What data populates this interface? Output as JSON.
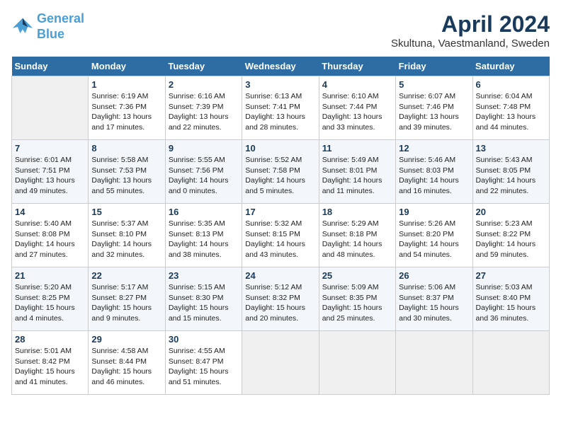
{
  "header": {
    "logo_line1": "General",
    "logo_line2": "Blue",
    "month": "April 2024",
    "location": "Skultuna, Vaestmanland, Sweden"
  },
  "weekdays": [
    "Sunday",
    "Monday",
    "Tuesday",
    "Wednesday",
    "Thursday",
    "Friday",
    "Saturday"
  ],
  "weeks": [
    [
      {
        "day": "",
        "info": ""
      },
      {
        "day": "1",
        "info": "Sunrise: 6:19 AM\nSunset: 7:36 PM\nDaylight: 13 hours\nand 17 minutes."
      },
      {
        "day": "2",
        "info": "Sunrise: 6:16 AM\nSunset: 7:39 PM\nDaylight: 13 hours\nand 22 minutes."
      },
      {
        "day": "3",
        "info": "Sunrise: 6:13 AM\nSunset: 7:41 PM\nDaylight: 13 hours\nand 28 minutes."
      },
      {
        "day": "4",
        "info": "Sunrise: 6:10 AM\nSunset: 7:44 PM\nDaylight: 13 hours\nand 33 minutes."
      },
      {
        "day": "5",
        "info": "Sunrise: 6:07 AM\nSunset: 7:46 PM\nDaylight: 13 hours\nand 39 minutes."
      },
      {
        "day": "6",
        "info": "Sunrise: 6:04 AM\nSunset: 7:48 PM\nDaylight: 13 hours\nand 44 minutes."
      }
    ],
    [
      {
        "day": "7",
        "info": "Sunrise: 6:01 AM\nSunset: 7:51 PM\nDaylight: 13 hours\nand 49 minutes."
      },
      {
        "day": "8",
        "info": "Sunrise: 5:58 AM\nSunset: 7:53 PM\nDaylight: 13 hours\nand 55 minutes."
      },
      {
        "day": "9",
        "info": "Sunrise: 5:55 AM\nSunset: 7:56 PM\nDaylight: 14 hours\nand 0 minutes."
      },
      {
        "day": "10",
        "info": "Sunrise: 5:52 AM\nSunset: 7:58 PM\nDaylight: 14 hours\nand 5 minutes."
      },
      {
        "day": "11",
        "info": "Sunrise: 5:49 AM\nSunset: 8:01 PM\nDaylight: 14 hours\nand 11 minutes."
      },
      {
        "day": "12",
        "info": "Sunrise: 5:46 AM\nSunset: 8:03 PM\nDaylight: 14 hours\nand 16 minutes."
      },
      {
        "day": "13",
        "info": "Sunrise: 5:43 AM\nSunset: 8:05 PM\nDaylight: 14 hours\nand 22 minutes."
      }
    ],
    [
      {
        "day": "14",
        "info": "Sunrise: 5:40 AM\nSunset: 8:08 PM\nDaylight: 14 hours\nand 27 minutes."
      },
      {
        "day": "15",
        "info": "Sunrise: 5:37 AM\nSunset: 8:10 PM\nDaylight: 14 hours\nand 32 minutes."
      },
      {
        "day": "16",
        "info": "Sunrise: 5:35 AM\nSunset: 8:13 PM\nDaylight: 14 hours\nand 38 minutes."
      },
      {
        "day": "17",
        "info": "Sunrise: 5:32 AM\nSunset: 8:15 PM\nDaylight: 14 hours\nand 43 minutes."
      },
      {
        "day": "18",
        "info": "Sunrise: 5:29 AM\nSunset: 8:18 PM\nDaylight: 14 hours\nand 48 minutes."
      },
      {
        "day": "19",
        "info": "Sunrise: 5:26 AM\nSunset: 8:20 PM\nDaylight: 14 hours\nand 54 minutes."
      },
      {
        "day": "20",
        "info": "Sunrise: 5:23 AM\nSunset: 8:22 PM\nDaylight: 14 hours\nand 59 minutes."
      }
    ],
    [
      {
        "day": "21",
        "info": "Sunrise: 5:20 AM\nSunset: 8:25 PM\nDaylight: 15 hours\nand 4 minutes."
      },
      {
        "day": "22",
        "info": "Sunrise: 5:17 AM\nSunset: 8:27 PM\nDaylight: 15 hours\nand 9 minutes."
      },
      {
        "day": "23",
        "info": "Sunrise: 5:15 AM\nSunset: 8:30 PM\nDaylight: 15 hours\nand 15 minutes."
      },
      {
        "day": "24",
        "info": "Sunrise: 5:12 AM\nSunset: 8:32 PM\nDaylight: 15 hours\nand 20 minutes."
      },
      {
        "day": "25",
        "info": "Sunrise: 5:09 AM\nSunset: 8:35 PM\nDaylight: 15 hours\nand 25 minutes."
      },
      {
        "day": "26",
        "info": "Sunrise: 5:06 AM\nSunset: 8:37 PM\nDaylight: 15 hours\nand 30 minutes."
      },
      {
        "day": "27",
        "info": "Sunrise: 5:03 AM\nSunset: 8:40 PM\nDaylight: 15 hours\nand 36 minutes."
      }
    ],
    [
      {
        "day": "28",
        "info": "Sunrise: 5:01 AM\nSunset: 8:42 PM\nDaylight: 15 hours\nand 41 minutes."
      },
      {
        "day": "29",
        "info": "Sunrise: 4:58 AM\nSunset: 8:44 PM\nDaylight: 15 hours\nand 46 minutes."
      },
      {
        "day": "30",
        "info": "Sunrise: 4:55 AM\nSunset: 8:47 PM\nDaylight: 15 hours\nand 51 minutes."
      },
      {
        "day": "",
        "info": ""
      },
      {
        "day": "",
        "info": ""
      },
      {
        "day": "",
        "info": ""
      },
      {
        "day": "",
        "info": ""
      }
    ]
  ]
}
